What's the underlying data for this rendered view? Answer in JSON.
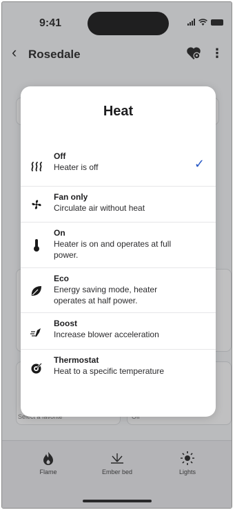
{
  "status_bar": {
    "time": "9:41"
  },
  "app_bar": {
    "title": "Rosedale"
  },
  "background": {
    "card_left_text": "Select a favorite",
    "card_right_text": "Off"
  },
  "dialog": {
    "title": "Heat",
    "options": [
      {
        "name": "Off",
        "description": "Heater is off",
        "icon": "heat-waves-icon",
        "selected": true
      },
      {
        "name": "Fan only",
        "description": "Circulate air without heat",
        "icon": "fan-icon",
        "selected": false
      },
      {
        "name": "On",
        "description": "Heater is on and operates at full power.",
        "icon": "thermometer-icon",
        "selected": false
      },
      {
        "name": "Eco",
        "description": "Energy saving mode, heater operates at half power.",
        "icon": "leaf-icon",
        "selected": false
      },
      {
        "name": "Boost",
        "description": "Increase blower acceleration",
        "icon": "boost-icon",
        "selected": false
      },
      {
        "name": "Thermostat",
        "description": "Heat to a specific temperature",
        "icon": "thermostat-icon",
        "selected": false
      }
    ],
    "check_color": "#2456c5"
  },
  "bottom_nav": {
    "items": [
      {
        "label": "Flame",
        "icon": "flame-icon"
      },
      {
        "label": "Ember bed",
        "icon": "ember-bed-icon"
      },
      {
        "label": "Lights",
        "icon": "sun-icon"
      }
    ]
  }
}
